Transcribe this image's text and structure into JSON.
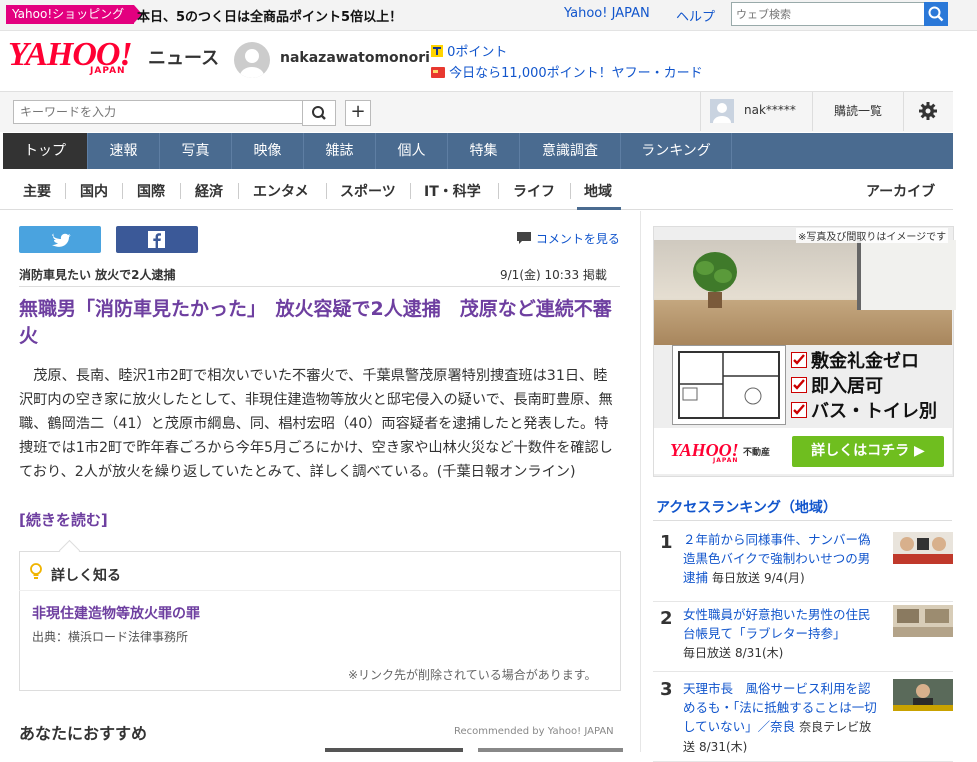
{
  "promo": {
    "badge": "Yahoo!ショッピング",
    "text": "本日、5のつく日は全商品ポイント5倍以上！",
    "links": {
      "yahoo_japan": "Yahoo! JAPAN",
      "help": "ヘルプ"
    },
    "search_placeholder": "ウェブ検索"
  },
  "header": {
    "logo_text": "YAHOO!",
    "logo_sub": "JAPAN",
    "service": "ニュース",
    "username": "nakazawatomonori",
    "tpoint": "0ポイント",
    "card_promo": "今日なら11,000ポイント！ヤフー・カード"
  },
  "search": {
    "placeholder": "キーワードを入力",
    "plus": "+",
    "user_masked": "nak*****",
    "subscriptions": "購読一覧"
  },
  "nav": {
    "items": [
      "トップ",
      "速報",
      "写真",
      "映像",
      "雑誌",
      "個人",
      "特集",
      "意識調査",
      "ランキング"
    ],
    "active": 0
  },
  "subnav": {
    "items": [
      "主要",
      "国内",
      "国際",
      "経済",
      "エンタメ",
      "スポーツ",
      "IT・科学",
      "ライフ",
      "地域"
    ],
    "active": 8,
    "archive": "アーカイブ"
  },
  "article": {
    "comment_link": "コメントを見る",
    "kicker": "消防車見たい 放火で2人逮捕",
    "date": "9/1(金) 10:33 掲載",
    "headline": "無職男「消防車見たかった」　放火容疑で2人逮捕　茂原など連続不審火",
    "body": "　茂原、長南、睦沢1市2町で相次いでいた不審火で、千葉県警茂原署特別捜査班は31日、睦沢町内の空き家に放火したとして、非現住建造物等放火と邸宅侵入の疑いで、長南町豊原、無職、鶴岡浩二（41）と茂原市綱島、同、椙村宏昭（40）両容疑者を逮捕したと発表した。特捜班では1市2町で昨年春ごろから今年5月ごろにかけ、空き家や山林火災など十数件を確認しており、2人が放火を繰り返していたとみて、詳しく調べている。(千葉日報オンライン)",
    "read_more": "[続きを読む]"
  },
  "detail": {
    "title": "詳しく知る",
    "link": "非現住建造物等放火罪の罪",
    "source": "出典：横浜ロード法律事務所",
    "note": "※リンク先が削除されている場合があります。"
  },
  "recommend": {
    "title": "あなたにおすすめ",
    "credit": "Recommended by Yahoo! JAPAN"
  },
  "ad": {
    "disclaimer": "※写真及び間取りはイメージです",
    "bullets": [
      "敷金礼金ゼロ",
      "即入居可",
      "バス・トイレ別"
    ],
    "logo": "YAHOO!",
    "logo_sub": "JAPAN",
    "logo_service": "不動産",
    "cta": "詳しくはコチラ ▶"
  },
  "ranking": {
    "title": "アクセスランキング（地域）",
    "items": [
      {
        "rank": "1",
        "title": "２年前から同様事件、ナンバー偽造黒色バイクで強制わいせつの男逮捕",
        "source": "毎日放送",
        "date": "9/4(月)"
      },
      {
        "rank": "2",
        "title": "女性職員が好意抱いた男性の住民台帳見て「ラブレター持参」",
        "source": "毎日放送",
        "date": "8/31(木)"
      },
      {
        "rank": "3",
        "title": "天理市長　風俗サービス利用を認めるも・「法に抵触することは一切していない」／奈良",
        "source": "奈良テレビ放送",
        "date": "8/31(木)"
      }
    ]
  },
  "colors": {
    "yahoo_red": "#ff0033",
    "nav_blue": "#4a6b90",
    "headline_purple": "#6e3fa0",
    "link_blue": "#1155cc",
    "promo_pink": "#e3007f",
    "cta_green": "#6fbe1f"
  }
}
